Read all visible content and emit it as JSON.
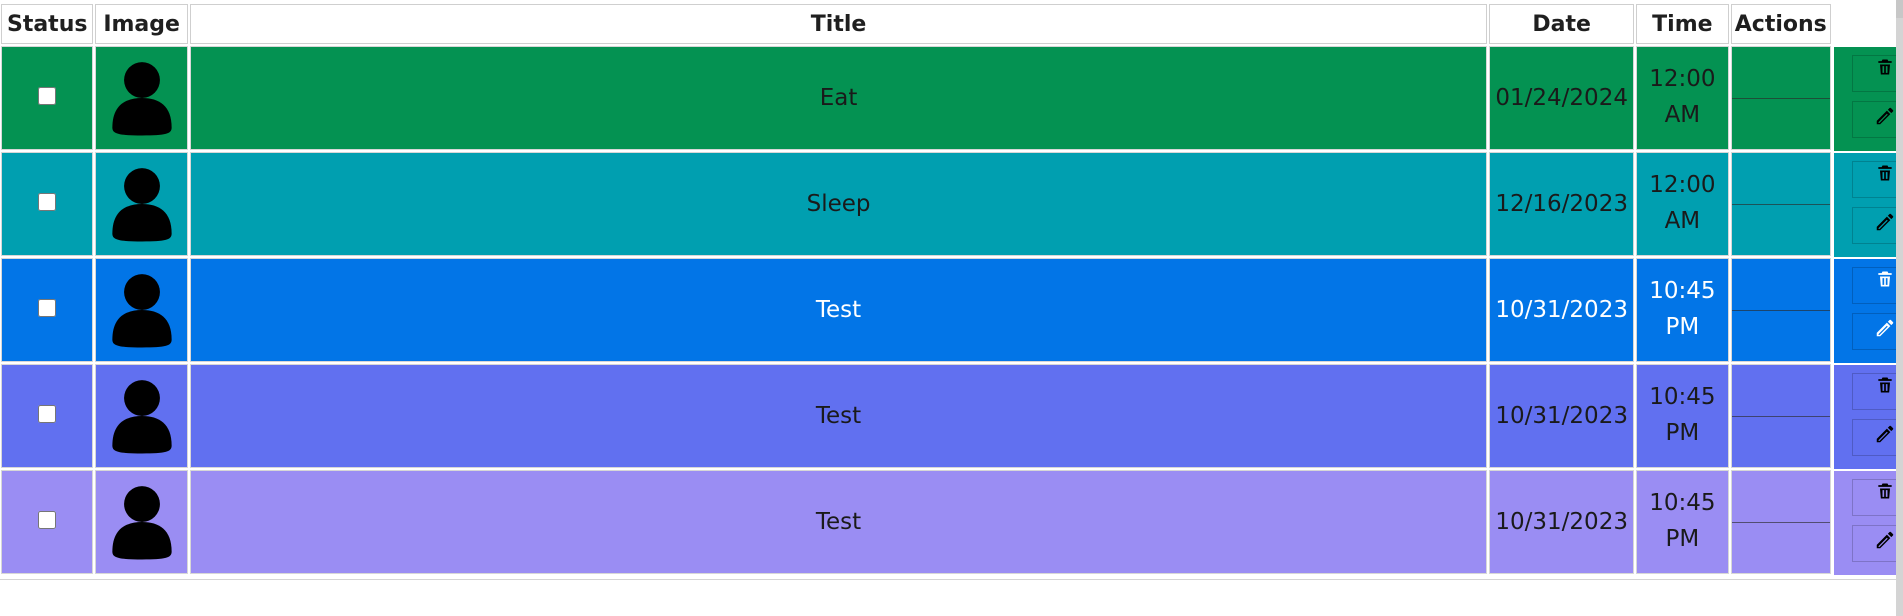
{
  "headers": {
    "status": "Status",
    "image": "Image",
    "title": "Title",
    "date": "Date",
    "time": "Time",
    "actions": "Actions"
  },
  "rows": [
    {
      "title": "Eat",
      "date": "01/24/2024",
      "time_line1": "12:00",
      "time_line2": "AM",
      "bg": "#049252",
      "text_color": "#1a1a1a",
      "icon_color": "#000000"
    },
    {
      "title": "Sleep",
      "date": "12/16/2023",
      "time_line1": "12:00",
      "time_line2": "AM",
      "bg": "#009fb0",
      "text_color": "#1a1a1a",
      "icon_color": "#000000"
    },
    {
      "title": "Test",
      "date": "10/31/2023",
      "time_line1": "10:45",
      "time_line2": "PM",
      "bg": "#0275e7",
      "text_color": "#ffffff",
      "icon_color": "#ffffff"
    },
    {
      "title": "Test",
      "date": "10/31/2023",
      "time_line1": "10:45",
      "time_line2": "PM",
      "bg": "#6170f0",
      "text_color": "#1a1a1a",
      "icon_color": "#000000"
    },
    {
      "title": "Test",
      "date": "10/31/2023",
      "time_line1": "10:45",
      "time_line2": "PM",
      "bg": "#9a8df3",
      "text_color": "#1a1a1a",
      "icon_color": "#000000"
    }
  ],
  "icons": {
    "avatar": "avatar-icon",
    "trash": "trash-icon",
    "edit": "pencil-icon"
  }
}
